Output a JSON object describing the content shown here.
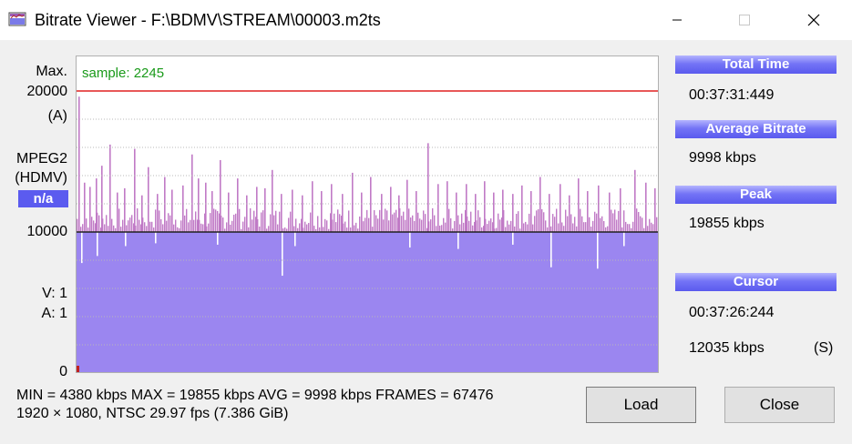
{
  "window": {
    "title": "Bitrate Viewer - F:\\BDMV\\STREAM\\00003.m2ts",
    "controls": {
      "minimize": "—",
      "maximize": "☐",
      "close": "✕"
    }
  },
  "graph": {
    "max_label": "Max.",
    "max_value": "20000",
    "max_scale_label": "(A)",
    "codec": "MPEG2",
    "codec_sub": "(HDMV)",
    "codec_badge": "n/a",
    "mid_value": "10000",
    "v_label": "V:  1",
    "a_label": "A:  1",
    "zero_value": "0",
    "sample_label": "sample: 2245"
  },
  "panel": {
    "total_time_label": "Total Time",
    "total_time": "00:37:31:449",
    "avg_bitrate_label": "Average Bitrate",
    "avg_bitrate": "9998 kbps",
    "peak_label": "Peak",
    "peak": "19855 kbps",
    "cursor_label": "Cursor",
    "cursor_time": "00:37:26:244",
    "cursor_bitrate": "12035 kbps",
    "cursor_mode": "(S)"
  },
  "stats": {
    "line1": "MIN = 4380 kbps  MAX = 19855 kbps  AVG = 9998 kbps  FRAMES = 67476",
    "line2": "1920 × 1080, NTSC 29.97 fps     (7.386 GiB)"
  },
  "buttons": {
    "load": "Load",
    "close": "Close"
  },
  "chart_data": {
    "type": "bar",
    "ylim": [
      0,
      20000
    ],
    "avg": 9998,
    "max": 19855,
    "min": 4380,
    "reference_lines": [
      20000,
      10000
    ],
    "grid": true,
    "colors": {
      "fill": "#9b86f0",
      "above_avg": "#c07ac6",
      "max_line": "#e02020",
      "avg_line": "#202020",
      "grid": "#b8b8b8"
    },
    "spikes": [
      {
        "x": 2,
        "v": 19600
      },
      {
        "x": 8,
        "v": 13500
      },
      {
        "x": 14,
        "v": 13200
      },
      {
        "x": 21,
        "v": 13800
      },
      {
        "x": 27,
        "v": 14700
      },
      {
        "x": 36,
        "v": 16200
      },
      {
        "x": 44,
        "v": 12800
      },
      {
        "x": 52,
        "v": 13100
      },
      {
        "x": 63,
        "v": 15900
      },
      {
        "x": 71,
        "v": 12600
      },
      {
        "x": 78,
        "v": 14600
      },
      {
        "x": 88,
        "v": 12700
      },
      {
        "x": 96,
        "v": 13900
      },
      {
        "x": 104,
        "v": 13000
      },
      {
        "x": 116,
        "v": 13300
      },
      {
        "x": 126,
        "v": 15500
      },
      {
        "x": 133,
        "v": 13800
      },
      {
        "x": 141,
        "v": 13500
      },
      {
        "x": 148,
        "v": 12900
      },
      {
        "x": 157,
        "v": 15100
      },
      {
        "x": 166,
        "v": 12800
      },
      {
        "x": 176,
        "v": 13800
      },
      {
        "x": 186,
        "v": 12600
      },
      {
        "x": 197,
        "v": 13200
      },
      {
        "x": 206,
        "v": 13100
      },
      {
        "x": 214,
        "v": 14400
      },
      {
        "x": 224,
        "v": 12700
      },
      {
        "x": 236,
        "v": 13000
      },
      {
        "x": 247,
        "v": 12600
      },
      {
        "x": 258,
        "v": 13600
      },
      {
        "x": 268,
        "v": 12900
      },
      {
        "x": 279,
        "v": 13400
      },
      {
        "x": 291,
        "v": 12700
      },
      {
        "x": 302,
        "v": 14200
      },
      {
        "x": 312,
        "v": 12800
      },
      {
        "x": 322,
        "v": 13900
      },
      {
        "x": 334,
        "v": 12700
      },
      {
        "x": 344,
        "v": 13200
      },
      {
        "x": 353,
        "v": 12600
      },
      {
        "x": 362,
        "v": 13700
      },
      {
        "x": 372,
        "v": 12900
      },
      {
        "x": 385,
        "v": 16300
      },
      {
        "x": 396,
        "v": 13400
      },
      {
        "x": 406,
        "v": 13600
      },
      {
        "x": 416,
        "v": 12800
      },
      {
        "x": 427,
        "v": 13400
      },
      {
        "x": 437,
        "v": 12700
      },
      {
        "x": 447,
        "v": 13600
      },
      {
        "x": 457,
        "v": 12800
      },
      {
        "x": 467,
        "v": 13000
      },
      {
        "x": 478,
        "v": 12700
      },
      {
        "x": 488,
        "v": 13300
      },
      {
        "x": 498,
        "v": 12900
      },
      {
        "x": 508,
        "v": 13900
      },
      {
        "x": 518,
        "v": 12700
      },
      {
        "x": 530,
        "v": 13400
      },
      {
        "x": 540,
        "v": 12600
      },
      {
        "x": 550,
        "v": 13800
      },
      {
        "x": 560,
        "v": 12900
      },
      {
        "x": 572,
        "v": 13300
      },
      {
        "x": 584,
        "v": 12800
      },
      {
        "x": 596,
        "v": 13100
      },
      {
        "x": 612,
        "v": 14400
      },
      {
        "x": 624,
        "v": 13500
      },
      {
        "x": 634,
        "v": 13100
      }
    ],
    "dips": [
      {
        "x": 5,
        "v": 7800
      },
      {
        "x": 22,
        "v": 8300
      },
      {
        "x": 53,
        "v": 9000
      },
      {
        "x": 86,
        "v": 9200
      },
      {
        "x": 154,
        "v": 9100
      },
      {
        "x": 225,
        "v": 6900
      },
      {
        "x": 239,
        "v": 9000
      },
      {
        "x": 365,
        "v": 8900
      },
      {
        "x": 418,
        "v": 8800
      },
      {
        "x": 478,
        "v": 9100
      },
      {
        "x": 520,
        "v": 7500
      },
      {
        "x": 571,
        "v": 7400
      },
      {
        "x": 600,
        "v": 9000
      }
    ]
  }
}
